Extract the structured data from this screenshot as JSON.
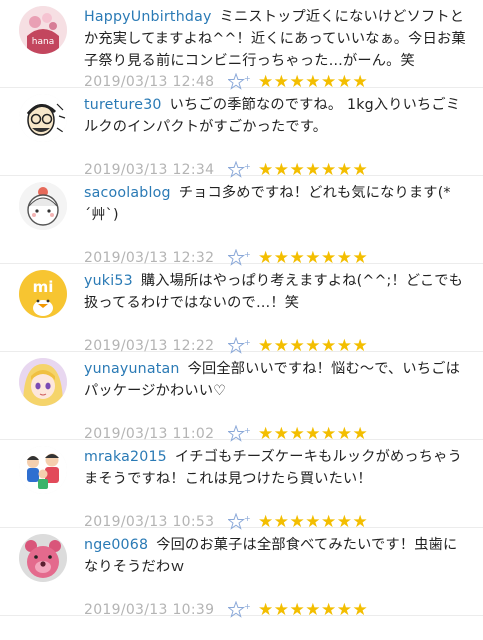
{
  "comments": [
    {
      "user": "HappyUnbirthday",
      "text": "ミニストップ近くにないけどソフトとか充実してますよね^^！近くにあっていいなぁ。今日お菓子祭り見る前にコンビニ行っちゃった…がーん。笑",
      "date": "2019/03/13 12:48",
      "stars": "★★★★★★★",
      "avatar": "hana-cupcake-icon",
      "avatar_label": "hana"
    },
    {
      "user": "tureture30",
      "text": "いちごの季節なのですね。 1kg入りいちごミルクのインパクトがすごかったです。",
      "date": "2019/03/13 12:34",
      "stars": "★★★★★★★",
      "avatar": "glasses-man-icon"
    },
    {
      "user": "sacoolablog",
      "text": "チョコ多めですね！どれも気になります(*´艸`)",
      "date": "2019/03/13 12:32",
      "stars": "★★★★★★★",
      "avatar": "girl-face-icon"
    },
    {
      "user": "yuki53",
      "text": "購入場所はやっぱり考えますよね(^^;！どこでも扱ってるわけではないので…！笑",
      "date": "2019/03/13 12:22",
      "stars": "★★★★★★★",
      "avatar": "yellow-duck-icon",
      "avatar_label": "mi"
    },
    {
      "user": "yunayunatan",
      "text": "今回全部いいですね！悩む～で、いちごはパッケージかわいい♡",
      "date": "2019/03/13 11:02",
      "stars": "★★★★★★★",
      "avatar": "anime-girl-icon"
    },
    {
      "user": "mraka2015",
      "text": "イチゴもチーズケーキもルックがめっちゃうまそうですね！これは見つけたら買いたい！",
      "date": "2019/03/13 10:53",
      "stars": "★★★★★★★",
      "avatar": "family-icon"
    },
    {
      "user": "nge0068",
      "text": "今回のお菓子は全部食べてみたいです！虫歯になりそうだわｗ",
      "date": "2019/03/13 10:39",
      "stars": "★★★★★★★",
      "avatar": "pink-bear-icon"
    }
  ],
  "colors": {
    "username": "#2a7ab5",
    "date": "#b4b4b4",
    "star": "#f3be00",
    "star_outline": "#8aa8d8"
  }
}
